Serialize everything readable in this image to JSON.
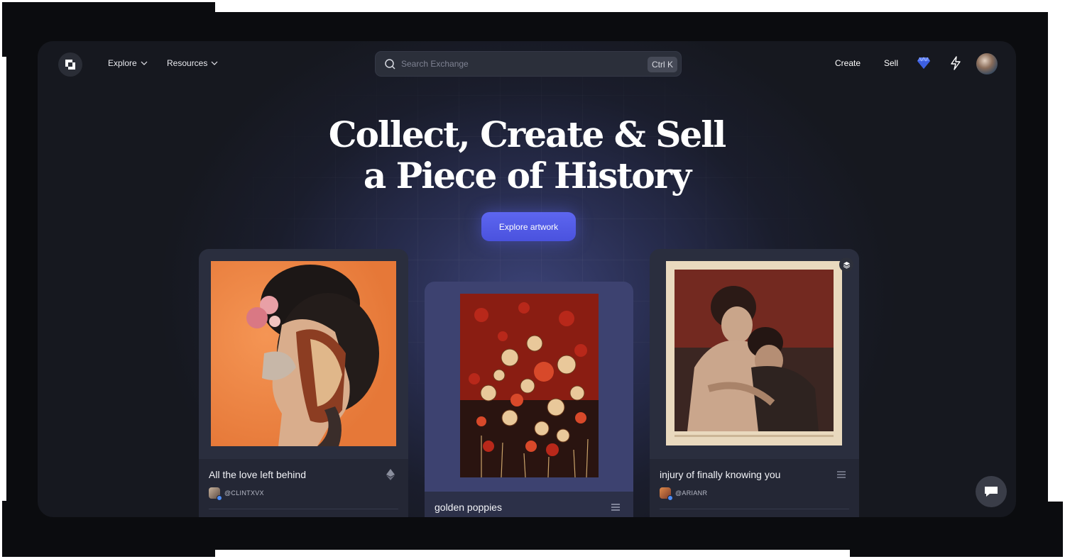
{
  "nav": {
    "explore_label": "Explore",
    "resources_label": "Resources",
    "search_placeholder": "Search Exchange",
    "search_shortcut": "Ctrl K",
    "create_label": "Create",
    "sell_label": "Sell"
  },
  "hero": {
    "title_line1": "Collect, Create & Sell",
    "title_line2": "a Piece of History",
    "cta_label": "Explore artwork"
  },
  "cards": [
    {
      "title": "All the love left behind",
      "author": "@CLINTXVX",
      "icon": "ethereum-icon"
    },
    {
      "title": "golden poppies",
      "author": "",
      "icon": "list-icon"
    },
    {
      "title": "injury of finally knowing you",
      "author": "@ARIANR",
      "icon": "list-icon"
    }
  ],
  "colors": {
    "accent": "#5a62ec",
    "background": "#16181f",
    "card": "#2a2e3e"
  }
}
